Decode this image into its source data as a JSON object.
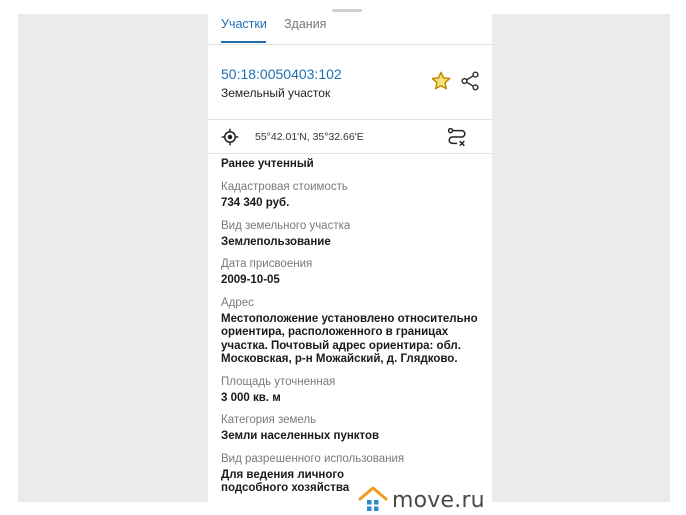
{
  "tabs": [
    {
      "label": "Участки",
      "active": true
    },
    {
      "label": "Здания",
      "active": false
    }
  ],
  "parcel": {
    "cadastral_number": "50:18:0050403:102",
    "type": "Земельный участок"
  },
  "icons": {
    "favorite": "star-icon",
    "share": "share-icon",
    "location": "crosshair-icon",
    "route": "route-icon"
  },
  "coordinates": "55°42.01'N, 35°32.66'E",
  "status": "Ранее учтенный",
  "fields": [
    {
      "label": "Кадастровая стоимость",
      "value": "734 340 руб."
    },
    {
      "label": "Вид земельного участка",
      "value": "Землепользование"
    },
    {
      "label": "Дата присвоения",
      "value": "2009-10-05"
    },
    {
      "label": "Адрес",
      "value": "Местоположение установлено относительно ориентира, расположенного в границах участка. Почтовый адрес ориентира: обл. Московская, р-н Можайский, д. Глядково."
    },
    {
      "label": "Площадь уточненная",
      "value": "3 000 кв. м"
    },
    {
      "label": "Категория земель",
      "value": "Земли населенных пунктов"
    },
    {
      "label": "Вид разрешенного использования",
      "value": "Для ведения личного подсобного хозяйства"
    }
  ],
  "watermark": {
    "text": "move.ru"
  },
  "colors": {
    "accent": "#1f6fb2",
    "star": "#e0a800",
    "watermark_orange": "#f29a1f",
    "watermark_blue": "#2e8bc9",
    "side_panel": "#ebebeb"
  }
}
